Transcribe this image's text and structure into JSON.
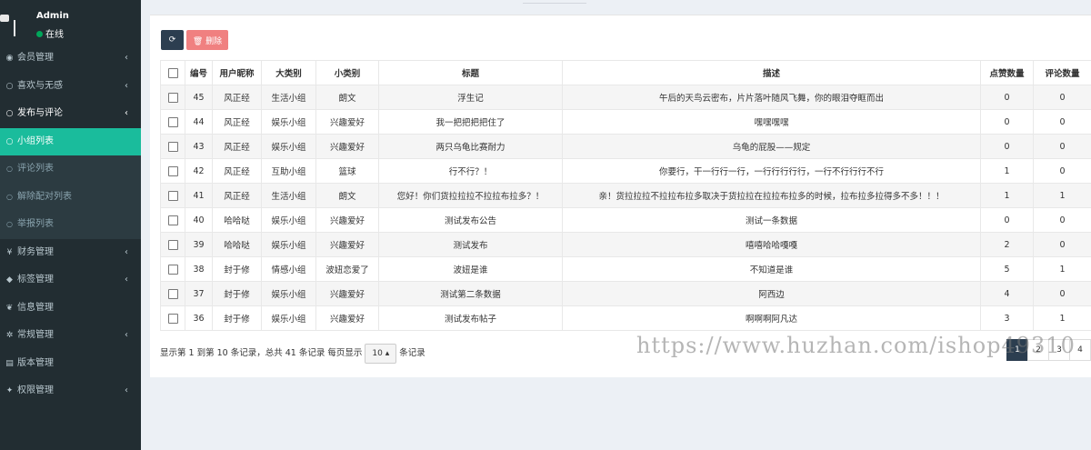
{
  "user": {
    "name": "Admin",
    "status": "在线"
  },
  "menu": [
    {
      "icon": "user-icon",
      "glyph": "◉",
      "label": "会员管理",
      "arrow": true,
      "state": "closed"
    },
    {
      "icon": "circle-icon",
      "glyph": "○",
      "label": "喜欢与无感",
      "arrow": true,
      "state": "closed"
    },
    {
      "icon": "circle-icon",
      "glyph": "○",
      "label": "发布与评论",
      "arrow": true,
      "state": "open"
    },
    {
      "icon": "circle-outline-icon",
      "glyph": "○",
      "label": "小组列表",
      "arrow": false,
      "state": "active"
    },
    {
      "icon": "circle-outline-icon",
      "glyph": "○",
      "label": "评论列表",
      "arrow": false,
      "state": "sub"
    },
    {
      "icon": "circle-outline-icon",
      "glyph": "○",
      "label": "解除配对列表",
      "arrow": false,
      "state": "sub"
    },
    {
      "icon": "circle-outline-icon",
      "glyph": "○",
      "label": "举报列表",
      "arrow": false,
      "state": "sub"
    },
    {
      "icon": "yen-icon",
      "glyph": "¥",
      "label": "财务管理",
      "arrow": true,
      "state": "closed"
    },
    {
      "icon": "tags-icon",
      "glyph": "◆",
      "label": "标签管理",
      "arrow": true,
      "state": "closed"
    },
    {
      "icon": "leaf-icon",
      "glyph": "❦",
      "label": "信息管理",
      "arrow": false,
      "state": "closed"
    },
    {
      "icon": "gear-icon",
      "glyph": "✲",
      "label": "常规管理",
      "arrow": true,
      "state": "closed"
    },
    {
      "icon": "file-icon",
      "glyph": "▤",
      "label": "版本管理",
      "arrow": false,
      "state": "closed"
    },
    {
      "icon": "users-icon",
      "glyph": "✦",
      "label": "权限管理",
      "arrow": true,
      "state": "closed"
    }
  ],
  "toolbar": {
    "refresh_glyph": "⟳",
    "delete_label": "🗑 删除"
  },
  "table": {
    "columns": [
      "编号",
      "用户昵称",
      "大类别",
      "小类别",
      "标题",
      "描述",
      "点赞数量",
      "评论数量"
    ],
    "rows": [
      [
        "45",
        "风正经",
        "生活小组",
        "朗文",
        "浮生记",
        "午后的天鸟云密布，片片落叶随风飞舞，你的眼泪夺眶而出",
        "0",
        "0"
      ],
      [
        "44",
        "风正经",
        "娱乐小组",
        "兴趣爱好",
        "我一把把把把住了",
        "嘿嘿嘿嘿",
        "0",
        "0"
      ],
      [
        "43",
        "风正经",
        "娱乐小组",
        "兴趣爱好",
        "两只乌龟比赛耐力",
        "乌龟的屁股——规定",
        "0",
        "0"
      ],
      [
        "42",
        "风正经",
        "互助小组",
        "篮球",
        "行不行？！",
        "你要行，干一行行一行，一行行行行行，一行不行行行不行",
        "1",
        "0"
      ],
      [
        "41",
        "风正经",
        "生活小组",
        "朗文",
        "您好！你们货拉拉拉不拉拉布拉多？！",
        "亲！货拉拉拉不拉拉布拉多取决于货拉拉在拉拉布拉多的时候，拉布拉多拉得多不多！！！",
        "1",
        "1"
      ],
      [
        "40",
        "哈哈哒",
        "娱乐小组",
        "兴趣爱好",
        "测试发布公告",
        "测试一条数据",
        "0",
        "0"
      ],
      [
        "39",
        "哈哈哒",
        "娱乐小组",
        "兴趣爱好",
        "测试发布",
        "嘻嘻哈哈嘎嘎",
        "2",
        "0"
      ],
      [
        "38",
        "封于修",
        "情感小组",
        "波妞恋爱了",
        "波妞是谁",
        "不知道是谁",
        "5",
        "1"
      ],
      [
        "37",
        "封于修",
        "娱乐小组",
        "兴趣爱好",
        "测试第二条数据",
        "阿西边",
        "4",
        "0"
      ],
      [
        "36",
        "封于修",
        "娱乐小组",
        "兴趣爱好",
        "测试发布帖子",
        "啊啊啊阿凡达",
        "3",
        "1"
      ]
    ]
  },
  "footer": {
    "summary": "显示第 1 到第 10 条记录，总共 41 条记录 每页显示",
    "page_size": "10 ▴",
    "suffix": "条记录"
  },
  "pagination": [
    {
      "label": "1",
      "current": true
    },
    {
      "label": "2",
      "current": false
    },
    {
      "label": "3",
      "current": false
    },
    {
      "label": "4",
      "current": false
    }
  ],
  "watermark": "https://www.huzhan.com/ishop49310"
}
